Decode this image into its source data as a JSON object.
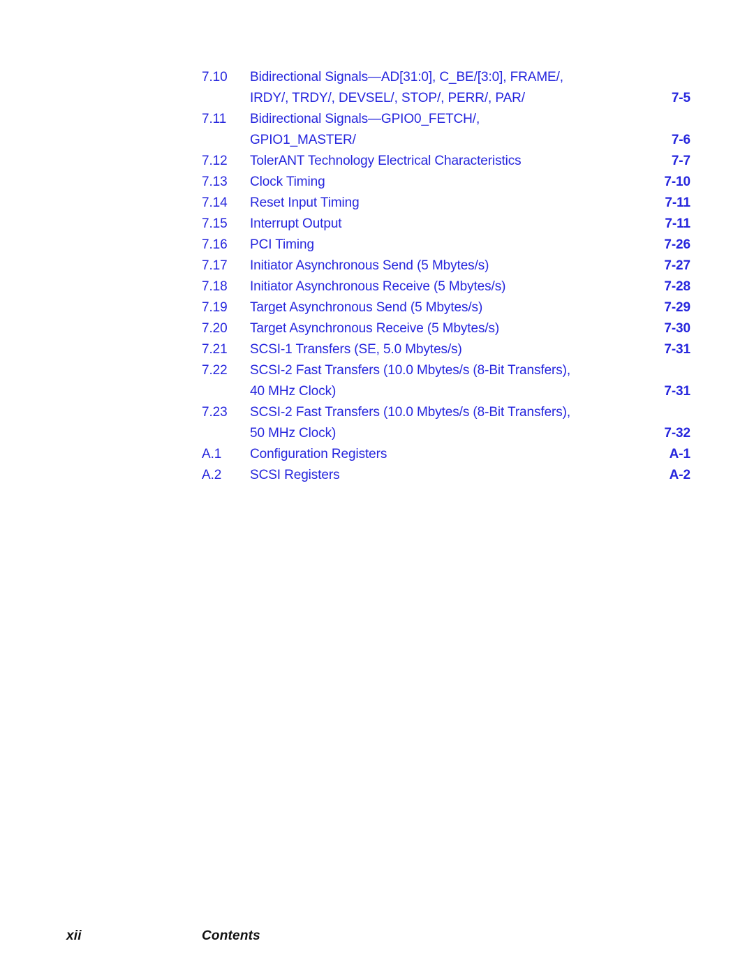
{
  "colors": {
    "entry_blue": "#2626dd",
    "footer_black": "#111111",
    "page_background": "#ffffff"
  },
  "toc": {
    "entries": [
      {
        "number": "7.10",
        "lines": [
          "Bidirectional Signals—AD[31:0], C_BE/[3:0], FRAME/,",
          "IRDY/, TRDY/, DEVSEL/, STOP/, PERR/, PAR/"
        ],
        "page": "7-5",
        "page_on_line": 1
      },
      {
        "number": "7.11",
        "lines": [
          "Bidirectional Signals—GPIO0_FETCH/,",
          "GPIO1_MASTER/"
        ],
        "page": "7-6",
        "page_on_line": 1
      },
      {
        "number": "7.12",
        "lines": [
          "TolerANT Technology Electrical Characteristics"
        ],
        "page": "7-7",
        "page_on_line": 0
      },
      {
        "number": "7.13",
        "lines": [
          "Clock Timing"
        ],
        "page": "7-10",
        "page_on_line": 0
      },
      {
        "number": "7.14",
        "lines": [
          "Reset Input Timing"
        ],
        "page": "7-11",
        "page_on_line": 0
      },
      {
        "number": "7.15",
        "lines": [
          "Interrupt Output"
        ],
        "page": "7-11",
        "page_on_line": 0
      },
      {
        "number": "7.16",
        "lines": [
          "PCI Timing"
        ],
        "page": "7-26",
        "page_on_line": 0
      },
      {
        "number": "7.17",
        "lines": [
          "Initiator Asynchronous Send (5 Mbytes/s)"
        ],
        "page": "7-27",
        "page_on_line": 0
      },
      {
        "number": "7.18",
        "lines": [
          "Initiator Asynchronous Receive (5 Mbytes/s)"
        ],
        "page": "7-28",
        "page_on_line": 0
      },
      {
        "number": "7.19",
        "lines": [
          "Target Asynchronous Send (5 Mbytes/s)"
        ],
        "page": "7-29",
        "page_on_line": 0
      },
      {
        "number": "7.20",
        "lines": [
          "Target Asynchronous Receive (5 Mbytes/s)"
        ],
        "page": "7-30",
        "page_on_line": 0
      },
      {
        "number": "7.21",
        "lines": [
          "SCSI-1 Transfers (SE, 5.0 Mbytes/s)"
        ],
        "page": "7-31",
        "page_on_line": 0
      },
      {
        "number": "7.22",
        "lines": [
          "SCSI-2 Fast Transfers (10.0 Mbytes/s (8-Bit Transfers),",
          "40 MHz Clock)"
        ],
        "page": "7-31",
        "page_on_line": 1
      },
      {
        "number": "7.23",
        "lines": [
          "SCSI-2 Fast Transfers (10.0 Mbytes/s (8-Bit Transfers),",
          "50 MHz Clock)"
        ],
        "page": "7-32",
        "page_on_line": 1
      },
      {
        "number": "A.1",
        "lines": [
          "Configuration Registers"
        ],
        "page": "A-1",
        "page_on_line": 0
      },
      {
        "number": "A.2",
        "lines": [
          "SCSI Registers"
        ],
        "page": "A-2",
        "page_on_line": 0
      }
    ]
  },
  "footer": {
    "folio": "xii",
    "label": "Contents"
  }
}
